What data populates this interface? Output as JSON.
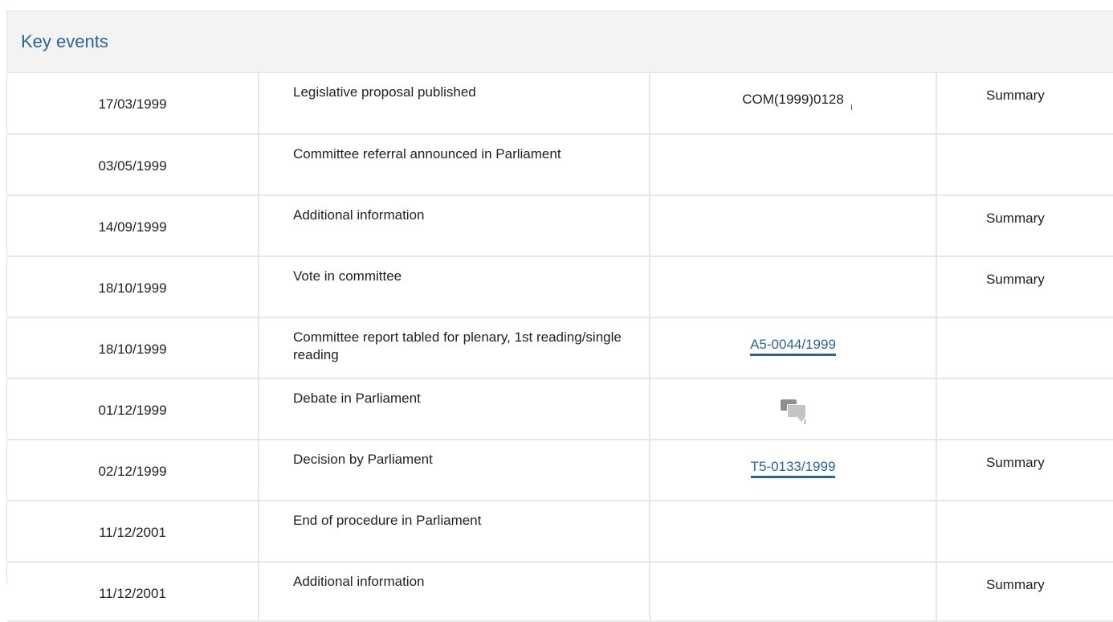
{
  "panel": {
    "title": "Key events"
  },
  "events": [
    {
      "date": "17/03/1999",
      "event": "Legislative proposal published",
      "doc": "COM(1999)0128",
      "doc_link": false,
      "summary": "Summary"
    },
    {
      "date": "03/05/1999",
      "event": "Committee referral announced in Parliament",
      "doc": "",
      "doc_link": false,
      "summary": ""
    },
    {
      "date": "14/09/1999",
      "event": "Additional information",
      "doc": "",
      "doc_link": false,
      "summary": "Summary"
    },
    {
      "date": "18/10/1999",
      "event": "Vote in committee",
      "doc": "",
      "doc_link": false,
      "summary": "Summary"
    },
    {
      "date": "18/10/1999",
      "event": "Committee report tabled for plenary, 1st reading/single reading",
      "doc": "A5-0044/1999",
      "doc_link": true,
      "summary": ""
    },
    {
      "date": "01/12/1999",
      "event": "Debate in Parliament",
      "doc": "",
      "doc_icon": "debate-icon",
      "doc_link": false,
      "summary": ""
    },
    {
      "date": "02/12/1999",
      "event": "Decision by Parliament",
      "doc": "T5-0133/1999",
      "doc_link": true,
      "summary": "Summary"
    },
    {
      "date": "11/12/2001",
      "event": "End of procedure in Parliament",
      "doc": "",
      "doc_link": false,
      "summary": ""
    },
    {
      "date": "11/12/2001",
      "event": "Additional information",
      "doc": "",
      "doc_link": false,
      "summary": "Summary"
    }
  ],
  "colors": {
    "title": "#2a6496",
    "link": "#2a6496",
    "header_bg": "#f3f3f3",
    "border": "#e6e6e6"
  }
}
